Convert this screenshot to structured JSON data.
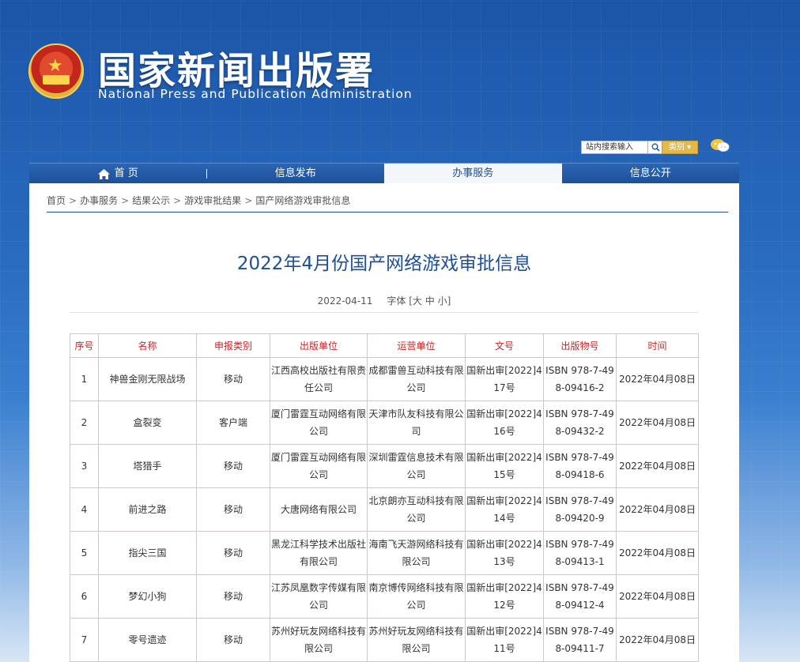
{
  "header": {
    "title": "国家新闻出版署",
    "subtitle": "National Press and Publication Administration"
  },
  "search": {
    "placeholder": "站内搜索输入",
    "category_label": "类别 ▾"
  },
  "nav": {
    "items": [
      {
        "label": "首 页",
        "icon": "home-icon"
      },
      {
        "label": "信息发布"
      },
      {
        "label": "办事服务",
        "active": true
      },
      {
        "label": "信息公开"
      }
    ]
  },
  "breadcrumb": [
    "首页",
    "办事服务",
    "结果公示",
    "游戏审批结果",
    "国产网络游戏审批信息"
  ],
  "article": {
    "title": "2022年4月份国产网络游戏审批信息",
    "date": "2022-04-11",
    "font_label": "字体 [",
    "font_sizes": [
      "大",
      "中",
      "小"
    ],
    "font_close": "]"
  },
  "table": {
    "headers": [
      "序号",
      "名称",
      "申报类别",
      "出版单位",
      "运营单位",
      "文号",
      "出版物号",
      "时间"
    ],
    "rows": [
      [
        "1",
        "神兽金刚无限战场",
        "移动",
        "江西高校出版社有限责任公司",
        "成都雷兽互动科技有限公司",
        "国新出审[2022]417号",
        "ISBN 978-7-498-09416-2",
        "2022年04月08日"
      ],
      [
        "2",
        "盒裂变",
        "客户端",
        "厦门雷霆互动网络有限公司",
        "天津市队友科技有限公司",
        "国新出审[2022]416号",
        "ISBN 978-7-498-09432-2",
        "2022年04月08日"
      ],
      [
        "3",
        "塔猎手",
        "移动",
        "厦门雷霆互动网络有限公司",
        "深圳雷霆信息技术有限公司",
        "国新出审[2022]415号",
        "ISBN 978-7-498-09418-6",
        "2022年04月08日"
      ],
      [
        "4",
        "前进之路",
        "移动",
        "大唐网络有限公司",
        "北京朗亦互动科技有限公司",
        "国新出审[2022]414号",
        "ISBN 978-7-498-09420-9",
        "2022年04月08日"
      ],
      [
        "5",
        "指尖三国",
        "移动",
        "黑龙江科学技术出版社有限公司",
        "海南飞天游网络科技有限公司",
        "国新出审[2022]413号",
        "ISBN 978-7-498-09413-1",
        "2022年04月08日"
      ],
      [
        "6",
        "梦幻小狗",
        "移动",
        "江苏凤凰数字传媒有限公司",
        "南京博传网络科技有限公司",
        "国新出审[2022]412号",
        "ISBN 978-7-498-09412-4",
        "2022年04月08日"
      ],
      [
        "7",
        "零号遗迹",
        "移动",
        "苏州好玩友网络科技有限公司",
        "苏州好玩友网络科技有限公司",
        "国新出审[2022]411号",
        "ISBN 978-7-498-09411-7",
        "2022年04月08日"
      ]
    ]
  }
}
